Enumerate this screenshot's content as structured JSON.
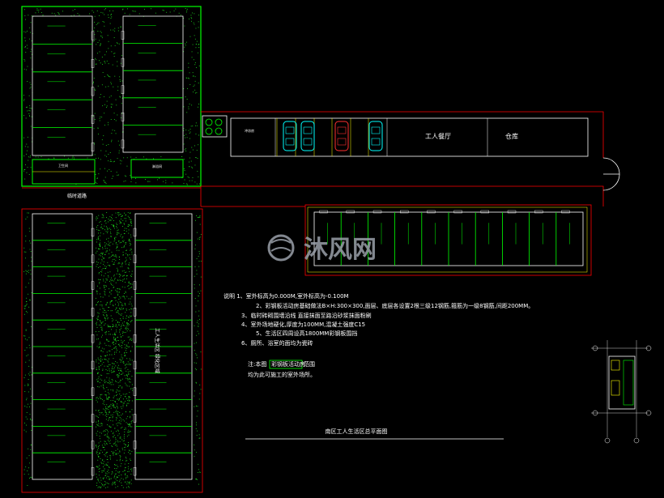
{
  "labels": {
    "temp_road": "临时道路",
    "canteen": "工人餐厅",
    "warehouse": "仓库",
    "toilet": "卫生间",
    "shower": "淋浴间",
    "bathroom": "冲凉房",
    "garden": "工人生活区 绿化区域",
    "title": "南区工人生活区总平面图",
    "watermark_text": "沐风网"
  },
  "notes": [
    "说明 1、室外标高为0.000M,室外标高为-0.100M",
    "2、彩钢板活动房基础做法B×H:300×300,面层、底层各设置2根三级12钢筋,箍筋为一级8钢筋,间距200MM。",
    "3、临时砖砌围墙沿线 直接抹面至路沿砂浆抹面粉刷",
    "4、室外场地硬化,厚度为100MM,混凝土强度C15",
    "5、生活区四周设高1800MM彩钢板围挡",
    "6、厕所、浴室的面均为瓷砖"
  ],
  "legend": {
    "prefix": "注:本图",
    "box": "彩钢板活动房",
    "suffix": "范围",
    "line2": "均为此可施工的室外场所。"
  },
  "colors": {
    "green": "#00ff00",
    "red": "#ff0000",
    "white": "#ffffff",
    "cyan": "#00ffff",
    "yellow": "#ffff00"
  }
}
